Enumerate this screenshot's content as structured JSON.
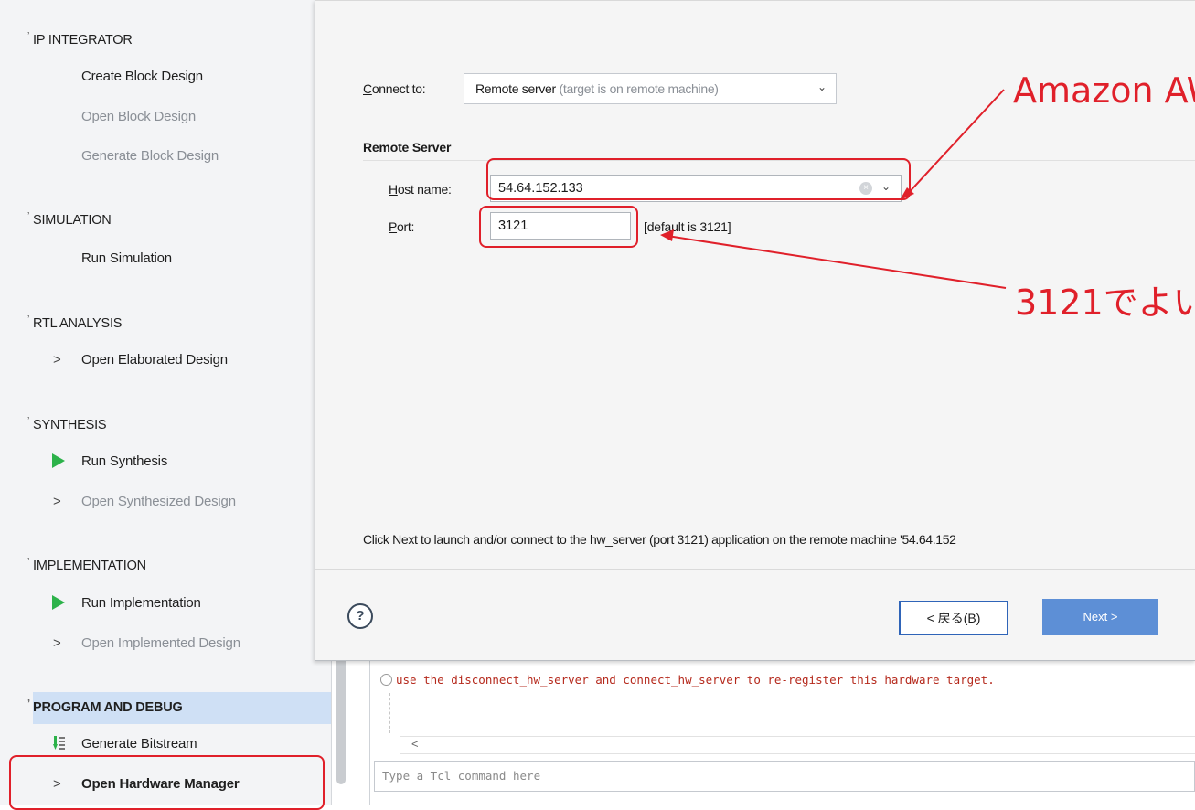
{
  "navigator": {
    "ip_integrator": {
      "title": "IP INTEGRATOR",
      "create": "Create Block Design",
      "open": "Open Block Design",
      "generate": "Generate Block Design"
    },
    "simulation": {
      "title": "SIMULATION",
      "run": "Run Simulation"
    },
    "rtl_analysis": {
      "title": "RTL ANALYSIS",
      "open_elaborated": "Open Elaborated Design"
    },
    "synthesis": {
      "title": "SYNTHESIS",
      "run": "Run Synthesis",
      "open": "Open Synthesized Design"
    },
    "implementation": {
      "title": "IMPLEMENTATION",
      "run": "Run Implementation",
      "open": "Open Implemented Design"
    },
    "program_and_debug": {
      "title": "PROGRAM AND DEBUG",
      "generate_bitstream": "Generate Bitstream",
      "open_hw_manager": "Open Hardware Manager"
    }
  },
  "console": {
    "message": "use the disconnect_hw_server and connect_hw_server to re-register this hardware target.",
    "input_placeholder": "Type a Tcl command here"
  },
  "dialog": {
    "connect_to_label_u": "C",
    "connect_to_label_rest": "onnect to:",
    "connect_to_value": "Remote server",
    "connect_to_value_hint": " (target is on remote machine)",
    "remote_server_heading": "Remote Server",
    "host_label_u": "H",
    "host_label_rest": "ost name:",
    "host_value": "54.64.152.133",
    "port_label_u": "P",
    "port_label_rest": "ort:",
    "port_value": "3121",
    "port_hint": "[default is 3121]",
    "info": "Click Next to launch and/or connect to the hw_server (port 3121) application on the remote machine '54.64.152",
    "help_label": "?",
    "back_label": "< 戻る(B)",
    "next_label": "Next >"
  },
  "annotations": {
    "aws_text": "Amazon AW",
    "port_text": "3121でよい"
  },
  "colors": {
    "annotation": "#e0202a",
    "selected_section": "#cfe0f5",
    "next_button": "#5d8fd6",
    "run_triangle": "#2cb24a",
    "console_error_text": "#b5291c"
  }
}
